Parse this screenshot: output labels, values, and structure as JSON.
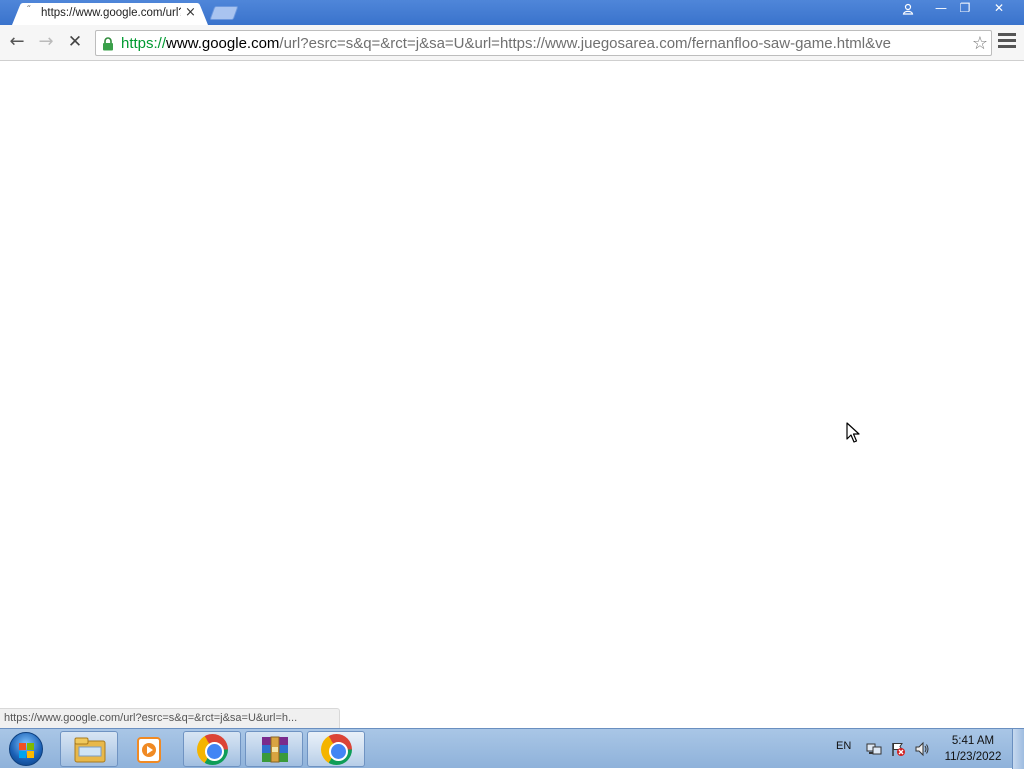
{
  "browser": {
    "tab": {
      "title": "https://www.google.com/url?esrc=s&q=&rct=j&sa=U&url=https://www.juegosarea.com/fernanfloo-saw-game.html",
      "favicon": "loading-spinner-icon",
      "close_glyph": "×"
    },
    "window_controls": {
      "user_icon": "user-icon",
      "minimize_glyph": "—",
      "maximize_glyph": "❐",
      "close_glyph": "✕"
    },
    "toolbar": {
      "back_glyph": "←",
      "forward_glyph": "→",
      "stop_glyph": "✕",
      "star_glyph": "☆"
    },
    "address_bar": {
      "scheme": "https://",
      "host": "www.google.com",
      "rest": "/url?esrc=s&q=&rct=j&sa=U&url=https://www.juegosarea.com/fernanfloo-saw-game.html&ve",
      "secure_color": "#009a31"
    },
    "status_bubble": "https://www.google.com/url?esrc=s&q=&rct=j&sa=U&url=h..."
  },
  "taskbar": {
    "apps": [
      {
        "name": "windows-explorer-icon"
      },
      {
        "name": "media-player-icon"
      },
      {
        "name": "chrome-icon"
      },
      {
        "name": "winrar-icon"
      },
      {
        "name": "chrome-icon"
      }
    ],
    "tray": {
      "language": "EN",
      "time": "5:41 AM",
      "date": "11/23/2022"
    }
  }
}
